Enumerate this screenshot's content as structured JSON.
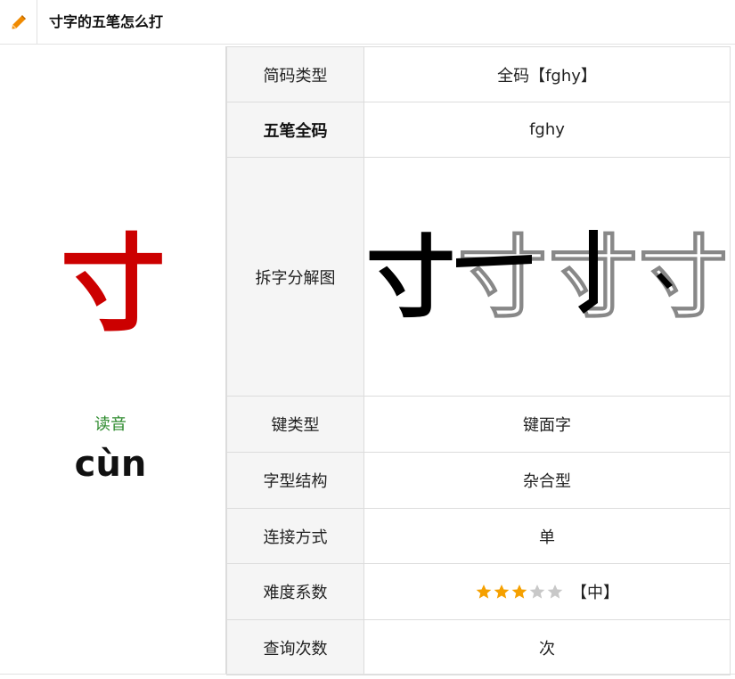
{
  "header": {
    "icon": "pencil-icon",
    "title": "寸字的五笔怎么打"
  },
  "character": {
    "glyph": "寸",
    "reading_label": "读音",
    "pinyin": "cùn",
    "color": "#cc0000"
  },
  "table": {
    "rows": [
      {
        "label": "简码类型",
        "value": "全码【fghy】"
      },
      {
        "label": "五笔全码",
        "value": "fghy"
      },
      {
        "label": "拆字分解图",
        "value": ""
      },
      {
        "label": "键类型",
        "value": "键面字"
      },
      {
        "label": "字型结构",
        "value": "杂合型"
      },
      {
        "label": "连接方式",
        "value": "单"
      },
      {
        "label": "难度系数",
        "value": "【中】"
      },
      {
        "label": "查询次数",
        "value": "次"
      }
    ],
    "decomposition_glyphs": [
      "寸",
      "寸",
      "寸",
      "寸"
    ],
    "difficulty": {
      "rating": 3,
      "max": 5,
      "filled_color": "#f5a000",
      "empty_color": "#c8c8c8"
    }
  }
}
